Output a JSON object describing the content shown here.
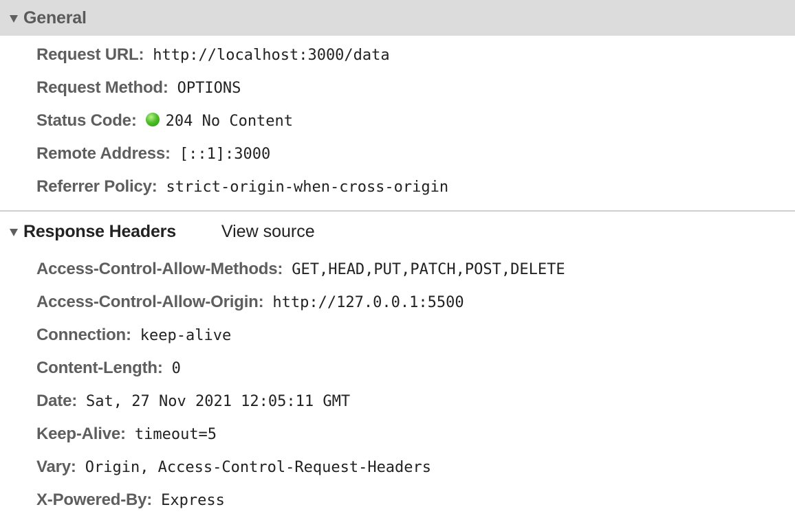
{
  "general": {
    "title": "General",
    "rows": [
      {
        "key": "Request URL:",
        "value": "http://localhost:3000/data"
      },
      {
        "key": "Request Method:",
        "value": "OPTIONS"
      },
      {
        "key": "Status Code:",
        "value": "204 No Content"
      },
      {
        "key": "Remote Address:",
        "value": "[::1]:3000"
      },
      {
        "key": "Referrer Policy:",
        "value": "strict-origin-when-cross-origin"
      }
    ]
  },
  "response_headers": {
    "title": "Response Headers",
    "view_source_label": "View source",
    "rows": [
      {
        "key": "Access-Control-Allow-Methods:",
        "value": "GET,HEAD,PUT,PATCH,POST,DELETE"
      },
      {
        "key": "Access-Control-Allow-Origin:",
        "value": "http://127.0.0.1:5500"
      },
      {
        "key": "Connection:",
        "value": "keep-alive"
      },
      {
        "key": "Content-Length:",
        "value": "0"
      },
      {
        "key": "Date:",
        "value": "Sat, 27 Nov 2021 12:05:11 GMT"
      },
      {
        "key": "Keep-Alive:",
        "value": "timeout=5"
      },
      {
        "key": "Vary:",
        "value": "Origin, Access-Control-Request-Headers"
      },
      {
        "key": "X-Powered-By:",
        "value": "Express"
      }
    ]
  },
  "colors": {
    "status_ok": "#4ec02a",
    "section_bg": "#dcdcdc"
  },
  "icons": {
    "collapse": "triangle-down-icon",
    "status": "green-status-dot-icon"
  }
}
